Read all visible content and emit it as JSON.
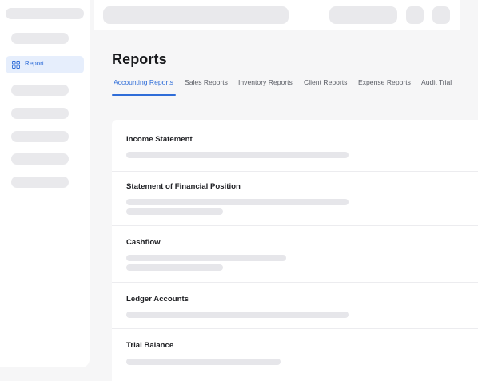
{
  "sidebar": {
    "active_item": {
      "label": "Report",
      "icon": "grid-icon"
    }
  },
  "main": {
    "title": "Reports",
    "tabs": [
      {
        "label": "Accounting Reports",
        "active": true
      },
      {
        "label": "Sales Reports"
      },
      {
        "label": "Inventory Reports"
      },
      {
        "label": "Client Reports"
      },
      {
        "label": "Expense Reports"
      },
      {
        "label": "Audit Trial"
      }
    ],
    "sections": [
      {
        "title": "Income Statement"
      },
      {
        "title": "Statement of Financial Position"
      },
      {
        "title": "Cashflow"
      },
      {
        "title": "Ledger Accounts"
      },
      {
        "title": "Trial Balance"
      }
    ]
  },
  "colors": {
    "accent": "#2f6dd8",
    "active_bg": "#e6eefc",
    "skeleton": "#e9e9ec",
    "background": "#f6f6f7"
  }
}
